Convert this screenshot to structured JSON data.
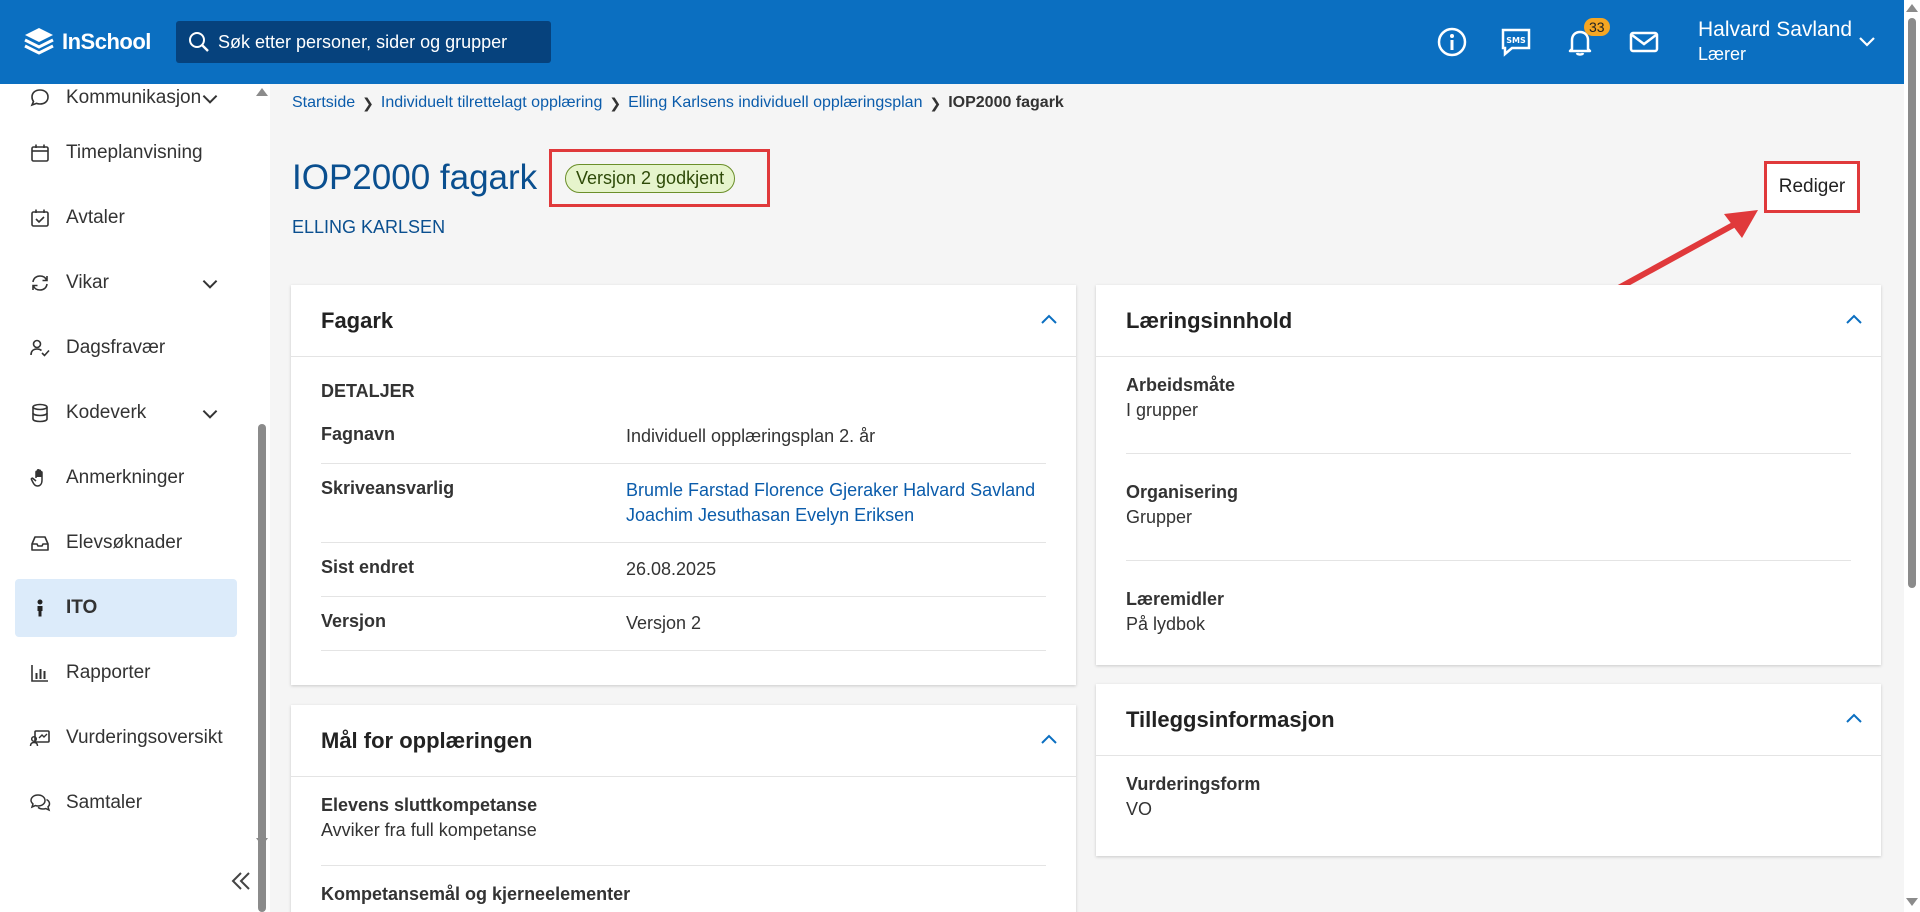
{
  "header": {
    "logo_text": "InSchool",
    "search_placeholder": "Søk etter personer, sider og grupper",
    "icons": [
      "info-icon",
      "sms-icon",
      "bell-icon",
      "mail-icon"
    ],
    "notification_count": "33",
    "user_name": "Halvard Savland",
    "user_role": "Lærer"
  },
  "sidebar": {
    "items": [
      {
        "label": "Kommunikasjon",
        "icon": "chat-icon",
        "expandable": true
      },
      {
        "label": "Timeplanvisning",
        "icon": "calendar-icon",
        "expandable": false
      },
      {
        "label": "Avtaler",
        "icon": "calendar-check-icon",
        "expandable": false
      },
      {
        "label": "Vikar",
        "icon": "sync-icon",
        "expandable": true
      },
      {
        "label": "Dagsfravær",
        "icon": "person-check-icon",
        "expandable": false
      },
      {
        "label": "Kodeverk",
        "icon": "database-icon",
        "expandable": true
      },
      {
        "label": "Anmerkninger",
        "icon": "hand-icon",
        "expandable": false
      },
      {
        "label": "Elevsøknader",
        "icon": "inbox-icon",
        "expandable": false
      },
      {
        "label": "ITO",
        "icon": "person-icon",
        "expandable": false,
        "active": true
      },
      {
        "label": "Rapporter",
        "icon": "bar-chart-icon",
        "expandable": false
      },
      {
        "label": "Vurderingsoversikt",
        "icon": "assessment-icon",
        "expandable": false
      },
      {
        "label": "Samtaler",
        "icon": "conversation-icon",
        "expandable": false
      }
    ]
  },
  "breadcrumb": {
    "items": [
      "Startside",
      "Individuelt tilrettelagt opplæring",
      "Elling Karlsens individuell opplæringsplan"
    ],
    "current": "IOP2000 fagark"
  },
  "page": {
    "title": "IOP2000 fagark",
    "status": "Versjon 2 godkjent",
    "student": "ELLING KARLSEN",
    "edit_label": "Rediger"
  },
  "fagark": {
    "title": "Fagark",
    "section": "DETALJER",
    "rows": [
      {
        "key": "Fagnavn",
        "value": "Individuell opplæringsplan 2. år"
      },
      {
        "key": "Skriveansvarlig",
        "value": "Brumle Farstad Florence Gjeraker Halvard Savland Joachim Jesuthasan Evelyn Eriksen"
      },
      {
        "key": "Sist endret",
        "value": "26.08.2025"
      },
      {
        "key": "Versjon",
        "value": "Versjon 2"
      }
    ]
  },
  "maal": {
    "title": "Mål for opplæringen",
    "fields": [
      {
        "key": "Elevens sluttkompetanse",
        "value": "Avviker fra full kompetanse"
      },
      {
        "key": "Kompetansemål og kjerneelementer",
        "value": ""
      }
    ]
  },
  "laeringsinnhold": {
    "title": "Læringsinnhold",
    "fields": [
      {
        "key": "Arbeidsmåte",
        "value": "I grupper"
      },
      {
        "key": "Organisering",
        "value": "Grupper"
      },
      {
        "key": "Læremidler",
        "value": "På lydbok"
      }
    ]
  },
  "tillegg": {
    "title": "Tilleggsinformasjon",
    "fields": [
      {
        "key": "Vurderingsform",
        "value": "VO"
      }
    ]
  }
}
